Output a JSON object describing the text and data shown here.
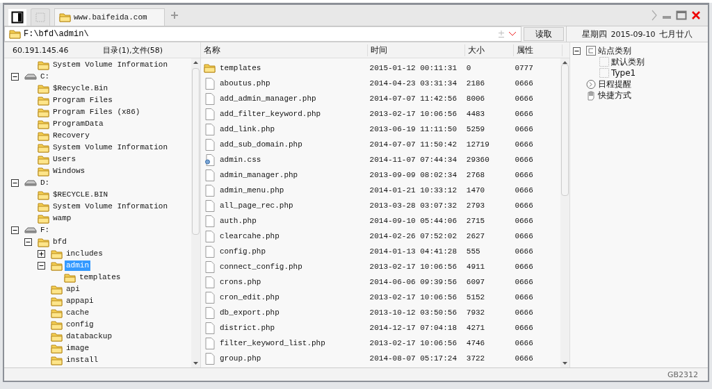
{
  "tabs": [
    {
      "kind": "panel",
      "selected": true
    },
    {
      "kind": "blank",
      "selected": false
    },
    {
      "kind": "site",
      "label": "www.baifeida.com",
      "selected": true
    }
  ],
  "path_bar": {
    "value": "F:\\bfd\\admin\\",
    "button": "读取"
  },
  "date": {
    "weekday": "星期四",
    "date": "2015-09-10",
    "lunar": "七月廿八"
  },
  "tree_header": {
    "host": "60.191.145.46",
    "summary": "目录(1),文件(58)"
  },
  "tree": [
    {
      "kind": "hidden",
      "children": [
        {
          "kind": "folder",
          "label": "System Volume Information",
          "selected": false
        }
      ]
    },
    {
      "kind": "drive",
      "label": "C:",
      "expanded": true,
      "selected": false,
      "children": [
        {
          "kind": "folder",
          "label": "$Recycle.Bin",
          "selected": false
        },
        {
          "kind": "folder",
          "label": "Program Files",
          "selected": false
        },
        {
          "kind": "folder",
          "label": "Program Files (x86)",
          "selected": false
        },
        {
          "kind": "folder",
          "label": "ProgramData",
          "selected": false
        },
        {
          "kind": "folder",
          "label": "Recovery",
          "selected": false
        },
        {
          "kind": "folder",
          "label": "System Volume Information",
          "selected": false
        },
        {
          "kind": "folder",
          "label": "Users",
          "selected": false
        },
        {
          "kind": "folder",
          "label": "Windows",
          "selected": false
        }
      ]
    },
    {
      "kind": "drive",
      "label": "D:",
      "expanded": true,
      "selected": false,
      "children": [
        {
          "kind": "folder",
          "label": "$RECYCLE.BIN",
          "selected": false
        },
        {
          "kind": "folder",
          "label": "System Volume Information",
          "selected": false
        },
        {
          "kind": "folder",
          "label": "wamp",
          "selected": false
        }
      ]
    },
    {
      "kind": "drive",
      "label": "F:",
      "expanded": true,
      "selected": false,
      "children": [
        {
          "kind": "folder",
          "label": "bfd",
          "expanded": true,
          "selected": false,
          "children": [
            {
              "kind": "folder",
              "label": "includes",
              "expanded": false,
              "selected": false
            },
            {
              "kind": "folder",
              "label": "admin",
              "expanded": true,
              "selected": true,
              "children": [
                {
                  "kind": "folder",
                  "label": "templates",
                  "selected": false
                }
              ]
            },
            {
              "kind": "folder",
              "label": "api",
              "selected": false
            },
            {
              "kind": "folder",
              "label": "appapi",
              "selected": false
            },
            {
              "kind": "folder",
              "label": "cache",
              "selected": false
            },
            {
              "kind": "folder",
              "label": "config",
              "selected": false
            },
            {
              "kind": "folder",
              "label": "databackup",
              "selected": false
            },
            {
              "kind": "folder",
              "label": "image",
              "selected": false
            },
            {
              "kind": "folder",
              "label": "install",
              "selected": false
            }
          ]
        }
      ]
    }
  ],
  "table": {
    "columns": [
      "名称",
      "时间",
      "大小",
      "属性"
    ],
    "rows": [
      {
        "kind": "folder",
        "name": "templates",
        "time": "2015-01-12 00:11:31",
        "size": "0",
        "attr": "0777"
      },
      {
        "kind": "file",
        "name": "aboutus.php",
        "time": "2014-04-23 03:31:34",
        "size": "2186",
        "attr": "0666"
      },
      {
        "kind": "file",
        "name": "add_admin_manager.php",
        "time": "2014-07-07 11:42:56",
        "size": "8006",
        "attr": "0666"
      },
      {
        "kind": "file",
        "name": "add_filter_keyword.php",
        "time": "2013-02-17 10:06:56",
        "size": "4483",
        "attr": "0666"
      },
      {
        "kind": "file",
        "name": "add_link.php",
        "time": "2013-06-19 11:11:50",
        "size": "5259",
        "attr": "0666"
      },
      {
        "kind": "file",
        "name": "add_sub_domain.php",
        "time": "2014-07-07 11:50:42",
        "size": "12719",
        "attr": "0666"
      },
      {
        "kind": "css",
        "name": "admin.css",
        "time": "2014-11-07 07:44:34",
        "size": "29360",
        "attr": "0666"
      },
      {
        "kind": "file",
        "name": "admin_manager.php",
        "time": "2013-09-09 08:02:34",
        "size": "2768",
        "attr": "0666"
      },
      {
        "kind": "file",
        "name": "admin_menu.php",
        "time": "2014-01-21 10:33:12",
        "size": "1470",
        "attr": "0666"
      },
      {
        "kind": "file",
        "name": "all_page_rec.php",
        "time": "2013-03-28 03:07:32",
        "size": "2793",
        "attr": "0666"
      },
      {
        "kind": "file",
        "name": "auth.php",
        "time": "2014-09-10 05:44:06",
        "size": "2715",
        "attr": "0666"
      },
      {
        "kind": "file",
        "name": "clearcahe.php",
        "time": "2014-02-26 07:52:02",
        "size": "2627",
        "attr": "0666"
      },
      {
        "kind": "file",
        "name": "config.php",
        "time": "2014-01-13 04:41:28",
        "size": "555",
        "attr": "0666"
      },
      {
        "kind": "file",
        "name": "connect_config.php",
        "time": "2013-02-17 10:06:56",
        "size": "4911",
        "attr": "0666"
      },
      {
        "kind": "file",
        "name": "crons.php",
        "time": "2014-06-06 09:39:56",
        "size": "6097",
        "attr": "0666"
      },
      {
        "kind": "file",
        "name": "cron_edit.php",
        "time": "2013-02-17 10:06:56",
        "size": "5152",
        "attr": "0666"
      },
      {
        "kind": "file",
        "name": "db_export.php",
        "time": "2013-10-12 03:50:56",
        "size": "7932",
        "attr": "0666"
      },
      {
        "kind": "file",
        "name": "district.php",
        "time": "2014-12-17 07:04:18",
        "size": "4271",
        "attr": "0666"
      },
      {
        "kind": "file",
        "name": "filter_keyword_list.php",
        "time": "2013-02-17 10:06:56",
        "size": "4746",
        "attr": "0666"
      },
      {
        "kind": "file",
        "name": "group.php",
        "time": "2014-08-07 05:17:24",
        "size": "3722",
        "attr": "0666"
      }
    ]
  },
  "side_tree": [
    {
      "kind": "category",
      "label": "站点类别",
      "expanded": true,
      "children": [
        {
          "kind": "item",
          "label": "默认类别"
        },
        {
          "kind": "item",
          "label": "Type1"
        }
      ]
    },
    {
      "kind": "schedule",
      "label": "日程提醒"
    },
    {
      "kind": "shortcut",
      "label": "快捷方式"
    }
  ],
  "status_bar": {
    "encoding": "GB2312"
  }
}
